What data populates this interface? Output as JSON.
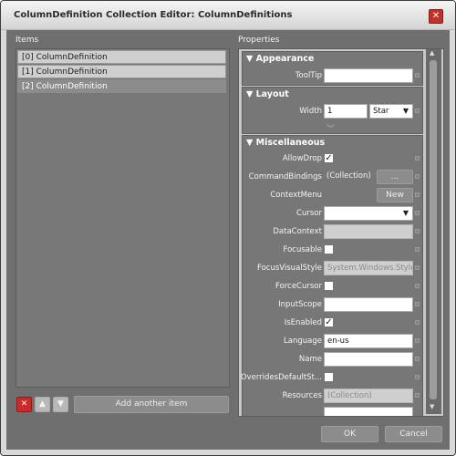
{
  "window": {
    "title": "ColumnDefinition Collection Editor: ColumnDefinitions",
    "close_glyph": "✕"
  },
  "items_label": "Items",
  "properties_label": "Properties",
  "items": [
    "[0] ColumnDefinition",
    "[1] ColumnDefinition",
    "[2] ColumnDefinition"
  ],
  "selected_item_index": 2,
  "item_buttons": {
    "delete_glyph": "✕",
    "up_glyph": "▲",
    "down_glyph": "▼",
    "add_label": "Add another item"
  },
  "sections": {
    "appearance": {
      "title": "Appearance",
      "tooltip_label": "ToolTip",
      "tooltip_value": ""
    },
    "layout": {
      "title": "Layout",
      "width_label": "Width",
      "width_value": "1",
      "width_unit": "Star"
    },
    "misc": {
      "title": "Miscellaneous",
      "allowdrop_label": "AllowDrop",
      "allowdrop_checked": "✓",
      "commandbindings_label": "CommandBindings",
      "commandbindings_value": "(Collection)",
      "commandbindings_button": "...",
      "contextmenu_label": "ContextMenu",
      "contextmenu_button": "New",
      "cursor_label": "Cursor",
      "cursor_value": "",
      "datacontext_label": "DataContext",
      "datacontext_value": "",
      "focusable_label": "Focusable",
      "focusvisualstyle_label": "FocusVisualStyle",
      "focusvisualstyle_value": "System.Windows.Style",
      "forcecursor_label": "ForceCursor",
      "inputscope_label": "InputScope",
      "inputscope_value": "",
      "isenabled_label": "IsEnabled",
      "isenabled_checked": "✓",
      "language_label": "Language",
      "language_value": "en-us",
      "name_label": "Name",
      "name_value": "",
      "overridesdefault_label": "OverridesDefaultSt...",
      "resources_label": "Resources",
      "resources_value": "(Collection)"
    }
  },
  "expand_glyph": "︾",
  "footer": {
    "ok_label": "OK",
    "cancel_label": "Cancel"
  },
  "colors": {
    "client_bg": "#6f6f6f",
    "delete_red": "#cc2a2a",
    "close_red": "#c2302b"
  }
}
